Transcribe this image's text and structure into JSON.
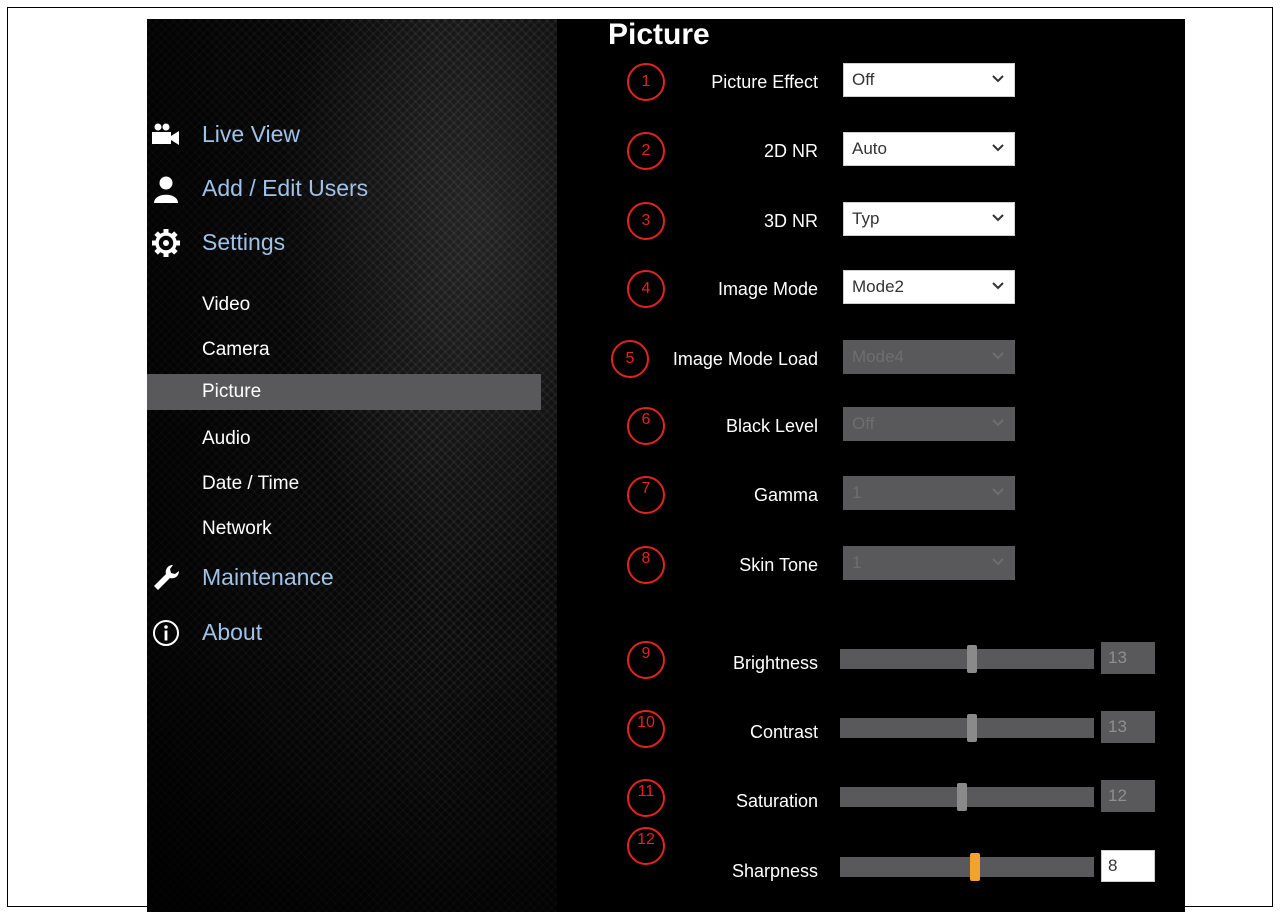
{
  "page_title": "Picture",
  "nav": {
    "main": [
      {
        "label": "Live View",
        "icon": "video-camera-icon"
      },
      {
        "label": "Add / Edit Users",
        "icon": "user-icon"
      },
      {
        "label": "Settings",
        "icon": "gear-icon"
      },
      {
        "label": "Maintenance",
        "icon": "wrench-icon"
      },
      {
        "label": "About",
        "icon": "info-icon"
      }
    ],
    "settings_sub": [
      "Video",
      "Camera",
      "Picture",
      "Audio",
      "Date / Time",
      "Network"
    ],
    "active_item": "Picture"
  },
  "fields": [
    {
      "marker": "1",
      "label": "Picture Effect",
      "type": "select",
      "value": "Off",
      "enabled": true
    },
    {
      "marker": "2",
      "label": "2D NR",
      "type": "select",
      "value": "Auto",
      "enabled": true
    },
    {
      "marker": "3",
      "label": "3D NR",
      "type": "select",
      "value": "Typ",
      "enabled": true
    },
    {
      "marker": "4",
      "label": "Image Mode",
      "type": "select",
      "value": "Mode2",
      "enabled": true
    },
    {
      "marker": "5",
      "label": "Image Mode Load",
      "type": "select",
      "value": "Mode4",
      "enabled": false
    },
    {
      "marker": "6",
      "label": "Black Level",
      "type": "select",
      "value": "Off",
      "enabled": false
    },
    {
      "marker": "7",
      "label": "Gamma",
      "type": "select",
      "value": "1",
      "enabled": false
    },
    {
      "marker": "8",
      "label": "Skin Tone",
      "type": "select",
      "value": "1",
      "enabled": false
    },
    {
      "marker": "9",
      "label": "Brightness",
      "type": "slider",
      "value": "13",
      "fill_fraction": 0.52,
      "enabled": false
    },
    {
      "marker": "10",
      "label": "Contrast",
      "type": "slider",
      "value": "13",
      "fill_fraction": 0.52,
      "enabled": false
    },
    {
      "marker": "11",
      "label": "Saturation",
      "type": "slider",
      "value": "12",
      "fill_fraction": 0.48,
      "enabled": false
    },
    {
      "marker": "12",
      "label": "Sharpness",
      "type": "slider",
      "value": "8",
      "fill_fraction": 0.53,
      "enabled": true
    }
  ],
  "colors": {
    "accent_nav": "#9fc2e8",
    "marker_red": "#e3231e",
    "slider_active": "#f1a32b",
    "active_bg": "#59595b"
  }
}
